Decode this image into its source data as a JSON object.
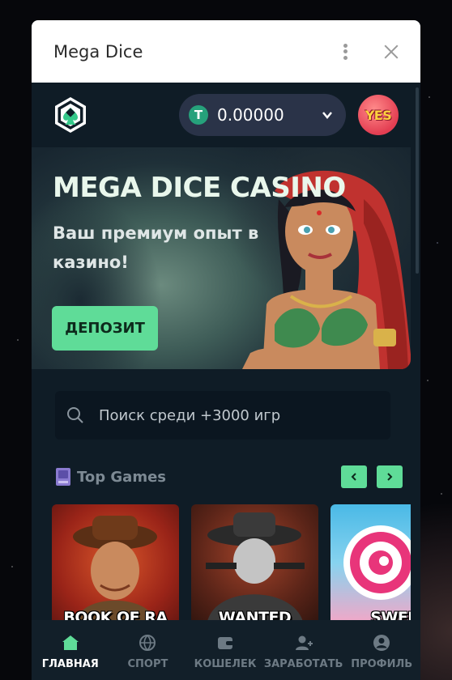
{
  "window": {
    "title": "Mega Dice"
  },
  "header": {
    "balance": "0.00000",
    "currency_symbol": "T",
    "avatar_text": "YES"
  },
  "banner": {
    "title": "MEGA DICE CASINO",
    "subtitle": "Ваш премиум опыт в казино!",
    "deposit_label": "ДЕПОЗИТ"
  },
  "search": {
    "placeholder": "Поиск среди +3000 игр"
  },
  "top_games": {
    "title": "Top Games",
    "games": [
      {
        "name": "BOOK OF RA"
      },
      {
        "name": "WANTED"
      },
      {
        "name": "SWEE"
      }
    ]
  },
  "bottom_nav": {
    "items": [
      {
        "label": "ГЛАВНАЯ",
        "icon": "home-icon",
        "active": true
      },
      {
        "label": "СПОРТ",
        "icon": "basketball-icon",
        "active": false
      },
      {
        "label": "КОШЕЛЕК",
        "icon": "wallet-icon",
        "active": false
      },
      {
        "label": "ЗАРАБОТАТЬ",
        "icon": "add-user-icon",
        "active": false
      },
      {
        "label": "ПРОФИЛЬ",
        "icon": "user-icon",
        "active": false
      }
    ]
  },
  "colors": {
    "accent": "#5fdc98",
    "background": "#0f1c26",
    "balance_pill": "#2a3348"
  }
}
